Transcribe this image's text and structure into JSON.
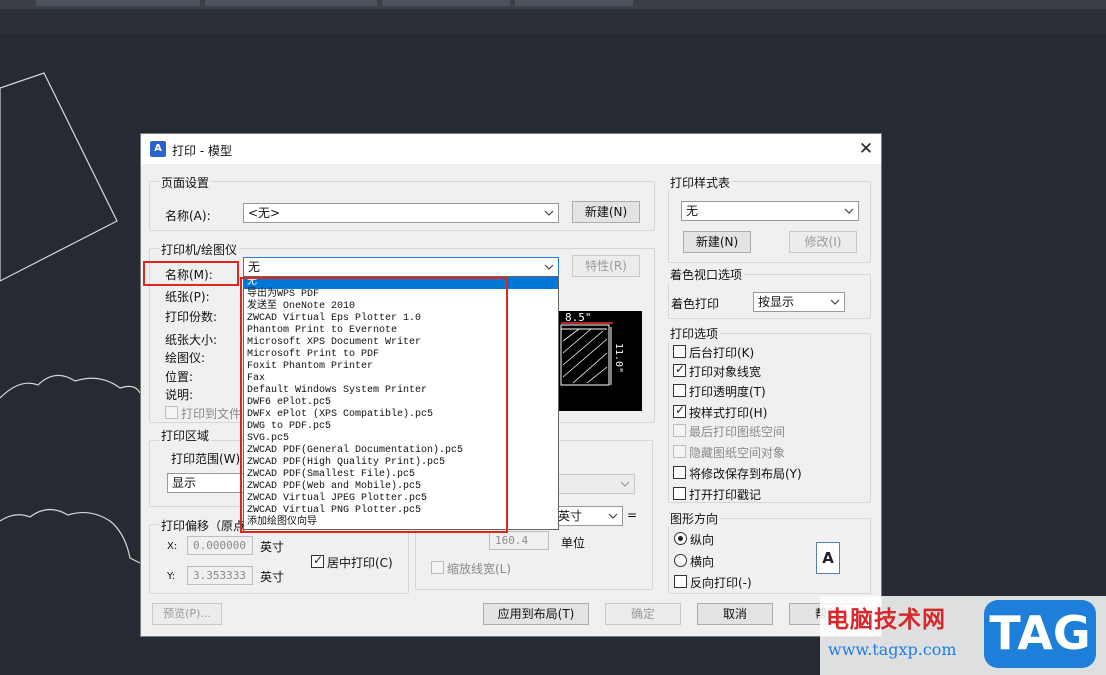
{
  "dialog": {
    "title": "打印 - 模型",
    "app_icon_text": "A",
    "close_glyph": "✕"
  },
  "page_setup": {
    "legend": "页面设置",
    "name_label": "名称(A):",
    "name_value": "<无>",
    "new_button": "新建(N)"
  },
  "printer": {
    "legend": "打印机/绘图仪",
    "name_label": "名称(M):",
    "name_value": "无",
    "properties_button": "特性(R)",
    "paper_label": "纸张(P):",
    "copies_label": "打印份数:",
    "paper_size_label": "纸张大小:",
    "plotter_label": "绘图仪:",
    "location_label": "位置:",
    "description_label": "说明:",
    "print_to_file_label": "打印到文件",
    "preview_width": "8.5\"",
    "preview_height": "11.0\""
  },
  "printer_dropdown": {
    "items": [
      "无",
      "导出为WPS PDF",
      "发送至 OneNote 2010",
      "ZWCAD Virtual Eps Plotter 1.0",
      "Phantom Print to Evernote",
      "Microsoft XPS Document Writer",
      "Microsoft Print to PDF",
      "Foxit Phantom Printer",
      "Fax",
      "Default Windows System Printer",
      "DWF6 ePlot.pc5",
      "DWFx ePlot (XPS Compatible).pc5",
      "DWG to PDF.pc5",
      "SVG.pc5",
      "ZWCAD PDF(General Documentation).pc5",
      "ZWCAD PDF(High Quality Print).pc5",
      "ZWCAD PDF(Smallest File).pc5",
      "ZWCAD PDF(Web and Mobile).pc5",
      "ZWCAD Virtual JPEG Plotter.pc5",
      "ZWCAD Virtual PNG Plotter.pc5",
      "添加绘图仪向导"
    ],
    "selected_index": 0
  },
  "plot_area": {
    "legend": "打印区域",
    "range_label": "打印范围(W)",
    "range_value": "显示"
  },
  "plot_offset": {
    "legend": "打印偏移（原点",
    "x_label": "X:",
    "x_value": "0.000000",
    "x_unit": "英寸",
    "y_label": "Y:",
    "y_value": "3.353333",
    "y_unit": "英寸",
    "center_label": "居中打印(C)",
    "center_checked": true
  },
  "scale": {
    "unit_value": "英寸",
    "equals": "=",
    "units_value": "160.4",
    "units_label": "单位",
    "scale_lineweights_label": "缩放线宽(L)"
  },
  "plot_style": {
    "legend": "打印样式表",
    "value": "无",
    "new_button": "新建(N)",
    "edit_button": "修改(I)"
  },
  "shaded_viewport": {
    "legend": "着色视口选项",
    "shade_label": "着色打印",
    "shade_value": "按显示"
  },
  "plot_options": {
    "legend": "打印选项",
    "items": [
      {
        "label": "后台打印(K)",
        "checked": false,
        "disabled": false
      },
      {
        "label": "打印对象线宽",
        "checked": true,
        "disabled": false
      },
      {
        "label": "打印透明度(T)",
        "checked": false,
        "disabled": false
      },
      {
        "label": "按样式打印(H)",
        "checked": true,
        "disabled": false
      },
      {
        "label": "最后打印图纸空间",
        "checked": false,
        "disabled": true
      },
      {
        "label": "隐藏图纸空间对象",
        "checked": false,
        "disabled": true
      },
      {
        "label": "将修改保存到布局(Y)",
        "checked": false,
        "disabled": false
      },
      {
        "label": "打开打印戳记",
        "checked": false,
        "disabled": false
      }
    ]
  },
  "orientation": {
    "legend": "图形方向",
    "portrait_label": "纵向",
    "landscape_label": "横向",
    "reverse_label": "反向打印(-)",
    "selected": "portrait",
    "icon_letter": "A"
  },
  "footer": {
    "preview_button": "预览(P)...",
    "apply_button": "应用到布局(T)",
    "ok_button": "确定",
    "cancel_button": "取消",
    "help_button": "帮助"
  },
  "watermark": {
    "line1": "电脑技术网",
    "line2": "www.tagxp.com",
    "tag": "TAG"
  },
  "colors": {
    "cad_background": "#252a33",
    "highlight_red": "#e1251b",
    "selection_blue": "#0078d7"
  }
}
